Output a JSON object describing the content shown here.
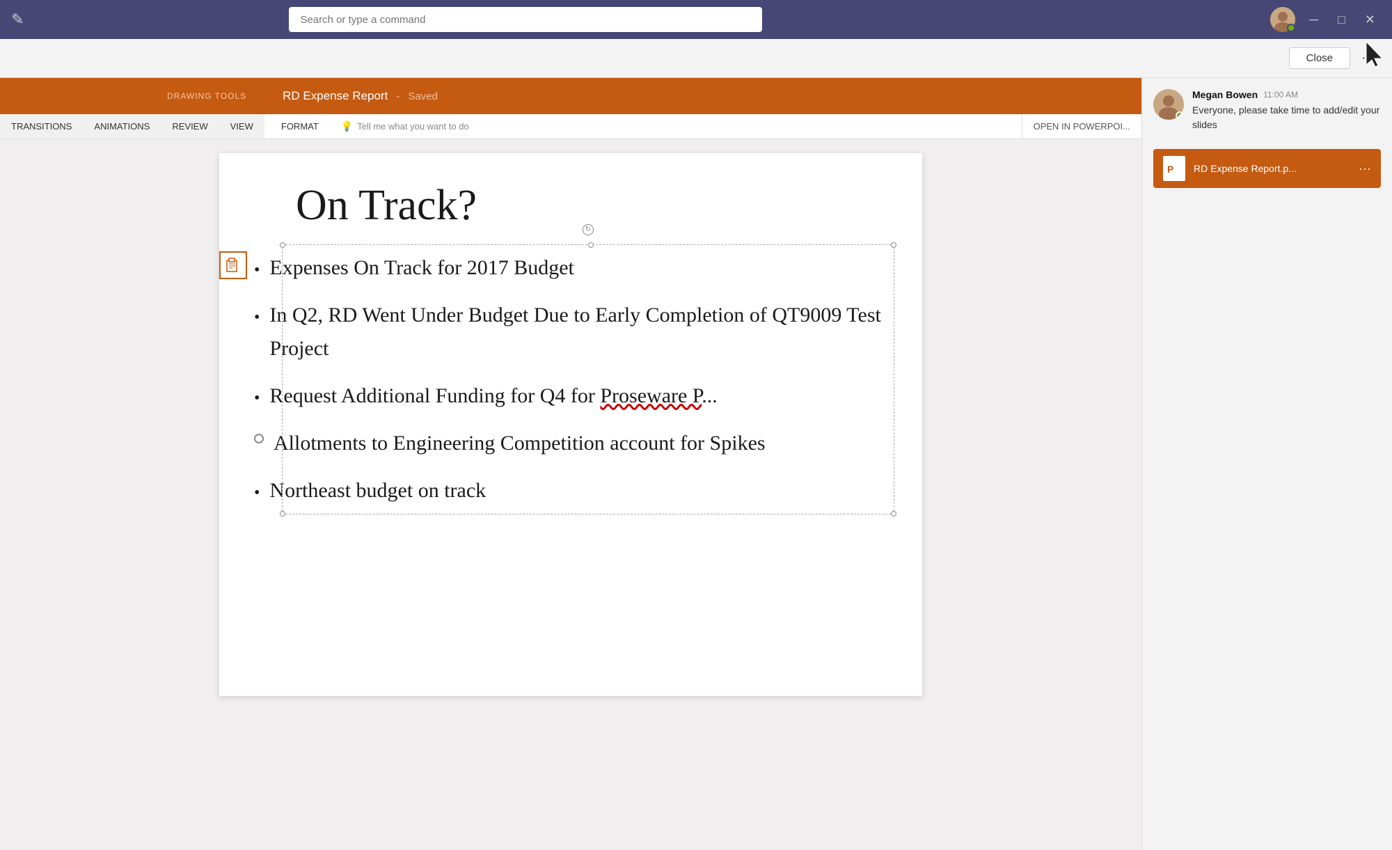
{
  "titleBar": {
    "searchPlaceholder": "Search or type a command",
    "minimize": "─",
    "maximize": "□",
    "close": "✕",
    "editIconLabel": "✎"
  },
  "toolbar": {
    "closeLabel": "Close",
    "moreLabel": "···"
  },
  "ppt": {
    "drawingTools": "DRAWING TOOLS",
    "fileName": "RD Expense Report",
    "dash": "-",
    "savedLabel": "Saved",
    "menuItems": [
      "TRANSITIONS",
      "ANIMATIONS",
      "REVIEW",
      "VIEW"
    ],
    "formatLabel": "FORMAT",
    "tellMe": "Tell me what you want to do",
    "openInPowerPoint": "OPEN IN POWERPOI..."
  },
  "slide": {
    "title": "On Track?",
    "bullets": [
      "Expenses On Track for 2017 Budget",
      "In Q2, RD Went Under Budget Due to Early Completion of QT9009 Test Project",
      "Request Additional Funding for Q4 for Proseware P...",
      "Allotments to Engineering Competition account for Spikes",
      "Northeast budget on track"
    ]
  },
  "notification": {
    "senderName": "Megan Bowen",
    "time": "11:00 AM",
    "message": "Everyone, please take time to add/edit your slides",
    "fileName": "RD Expense Report.p...",
    "fileMoreLabel": "···"
  },
  "colors": {
    "teamsHeader": "#464775",
    "pptOrange": "#c55a11",
    "online": "#6bb700"
  }
}
